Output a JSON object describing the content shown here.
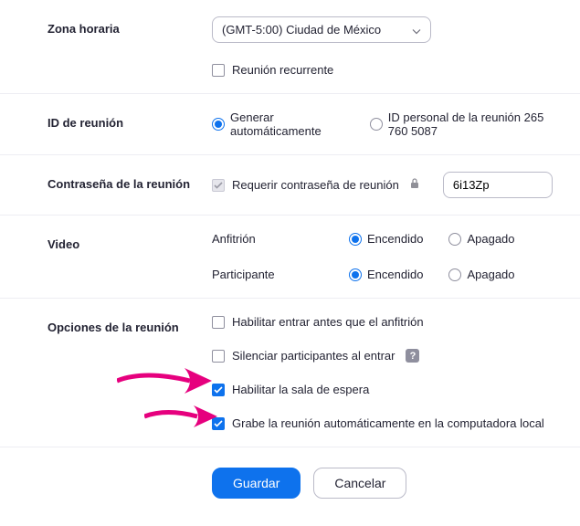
{
  "timezone": {
    "label": "Zona horaria",
    "selected": "(GMT-5:00) Ciudad de México",
    "recurring_label": "Reunión recurrente"
  },
  "meeting_id": {
    "label": "ID de reunión",
    "auto_label": "Generar automáticamente",
    "personal_label": "ID personal de la reunión 265 760 5087"
  },
  "password": {
    "label": "Contraseña de la reunión",
    "require_label": "Requerir contraseña de reunión",
    "value": "6i13Zp"
  },
  "video": {
    "label": "Video",
    "host_label": "Anfitrión",
    "participant_label": "Participante",
    "on_label": "Encendido",
    "off_label": "Apagado"
  },
  "options": {
    "label": "Opciones de la reunión",
    "join_before": "Habilitar entrar antes que el anfitrión",
    "mute_on_entry": "Silenciar participantes al entrar",
    "waiting_room": "Habilitar la sala de espera",
    "auto_record": "Grabe la reunión automáticamente en la computadora local"
  },
  "actions": {
    "save": "Guardar",
    "cancel": "Cancelar"
  },
  "colors": {
    "accent": "#0e72ed",
    "arrow": "#e6007e"
  }
}
